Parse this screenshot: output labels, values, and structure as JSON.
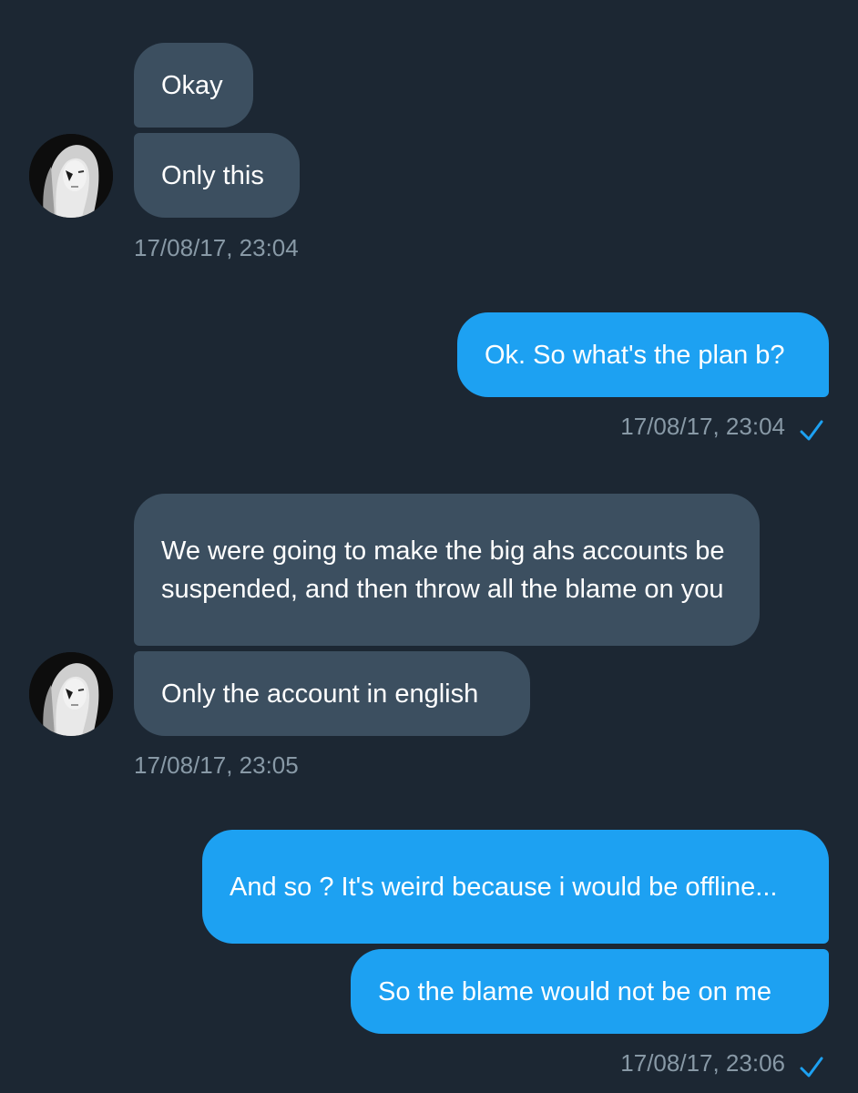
{
  "conversation": {
    "groups": [
      {
        "sender": "other",
        "messages": [
          "Okay",
          "Only this"
        ],
        "timestamp": "17/08/17, 23:04"
      },
      {
        "sender": "me",
        "messages": [
          "Ok. So what's the plan b?"
        ],
        "timestamp": "17/08/17, 23:04"
      },
      {
        "sender": "other",
        "messages": [
          "We were going to make the big ahs accounts be suspended, and then throw all the blame on you",
          "Only the account in english"
        ],
        "timestamp": "17/08/17, 23:05"
      },
      {
        "sender": "me",
        "messages": [
          "And so ? It's weird because i would be offline...",
          "So the blame would not be on me"
        ],
        "timestamp": "17/08/17, 23:06"
      }
    ]
  },
  "icons": {
    "read_receipt": "check-icon",
    "avatar": "user-avatar"
  },
  "colors": {
    "background": "#1c2733",
    "received_bubble": "#3c4f60",
    "sent_bubble": "#1da1f2",
    "timestamp": "#8899a6",
    "check": "#1da1f2"
  }
}
